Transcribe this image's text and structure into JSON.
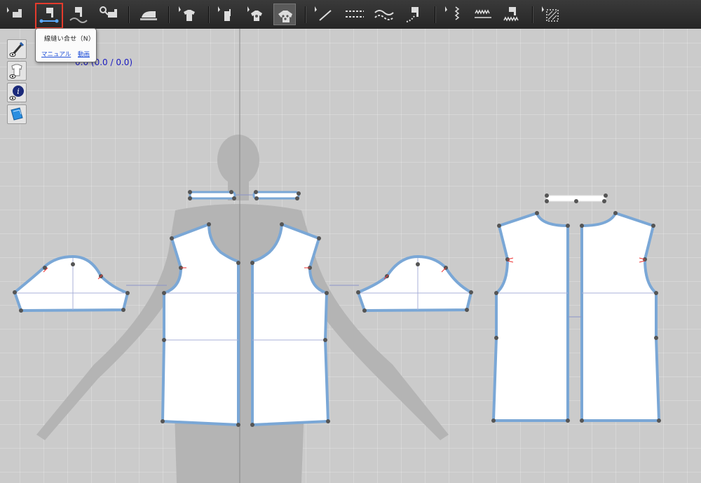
{
  "toolbar": {
    "tools": [
      {
        "name": "select-sewing-tool",
        "icon": "select-sewing-icon"
      },
      {
        "name": "line-sewing-tool",
        "icon": "line-sewing-icon",
        "highlighted": true
      },
      {
        "name": "free-sewing-tool",
        "icon": "free-sewing-icon"
      },
      {
        "name": "check-sewing-tool",
        "icon": "check-sewing-icon"
      },
      {
        "name": "iron-tool",
        "icon": "iron-icon"
      },
      {
        "name": "select-garment-tool",
        "icon": "tshirt-icon"
      },
      {
        "name": "tack-tool",
        "icon": "tack-icon"
      },
      {
        "name": "fold-tool",
        "icon": "fold-icon"
      },
      {
        "name": "fold-arrangement-tool",
        "icon": "fold-arrangement-icon",
        "active": true
      },
      {
        "name": "edit-line-tool",
        "icon": "edit-line-icon"
      },
      {
        "name": "dashed-line-tool",
        "icon": "dashed-line-icon"
      },
      {
        "name": "curve-line-tool",
        "icon": "curve-line-icon"
      },
      {
        "name": "topstitch-tool",
        "icon": "topstitch-icon"
      },
      {
        "name": "elastic-tool",
        "icon": "elastic-icon"
      },
      {
        "name": "zigzag-stitch-tool",
        "icon": "zigzag-stitch-icon"
      },
      {
        "name": "seam-taping-tool",
        "icon": "seam-taping-icon"
      },
      {
        "name": "pattern-select-tool",
        "icon": "pattern-select-icon"
      }
    ]
  },
  "tooltip": {
    "title": "線縫い合せ（N）",
    "manual_link": "マニュアル",
    "video_link": "動画"
  },
  "viewport": {
    "coordinate_readout": "0.0 (0.0 / 0.0)"
  },
  "side_toolbar": [
    {
      "name": "show-brush-button",
      "icon": "eye-brush-icon"
    },
    {
      "name": "show-garment-button",
      "icon": "eye-garment-icon"
    },
    {
      "name": "show-info-button",
      "icon": "eye-info-icon"
    },
    {
      "name": "show-texture-button",
      "icon": "texture-icon"
    }
  ],
  "colors": {
    "toolbar_bg": "#2e2e2e",
    "highlight": "#e53b2c",
    "seam_line": "#7aa7d6",
    "point": "#555555",
    "pattern_fill": "#ffffff",
    "link": "#1d4ed8",
    "coord_text": "#1a1ac0"
  }
}
